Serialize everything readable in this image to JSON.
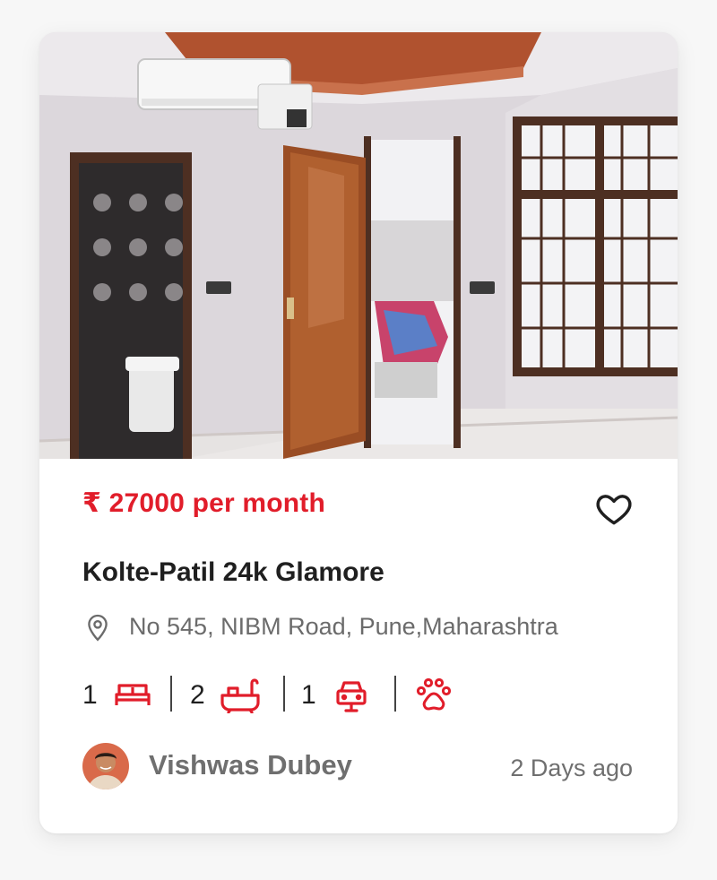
{
  "listing": {
    "price": "₹ 27000 per month",
    "title": "Kolte-Patil 24k Glamore",
    "address": "No 545, NIBM Road, Pune,Maharashtra"
  },
  "features": {
    "bedrooms": "1",
    "bathrooms": "2",
    "parking": "1",
    "bed_icon": "bed-icon",
    "bath_icon": "bathtub-icon",
    "car_icon": "car-icon",
    "pet_icon": "paw-icon"
  },
  "agent": {
    "name": "Vishwas Dubey",
    "posted": "2 Days ago"
  },
  "colors": {
    "accent": "#e11d2a",
    "text_dark": "#1f1f1f",
    "text_muted": "#6f6f6f",
    "card_bg": "#ffffff",
    "page_bg": "#f7f7f7"
  }
}
